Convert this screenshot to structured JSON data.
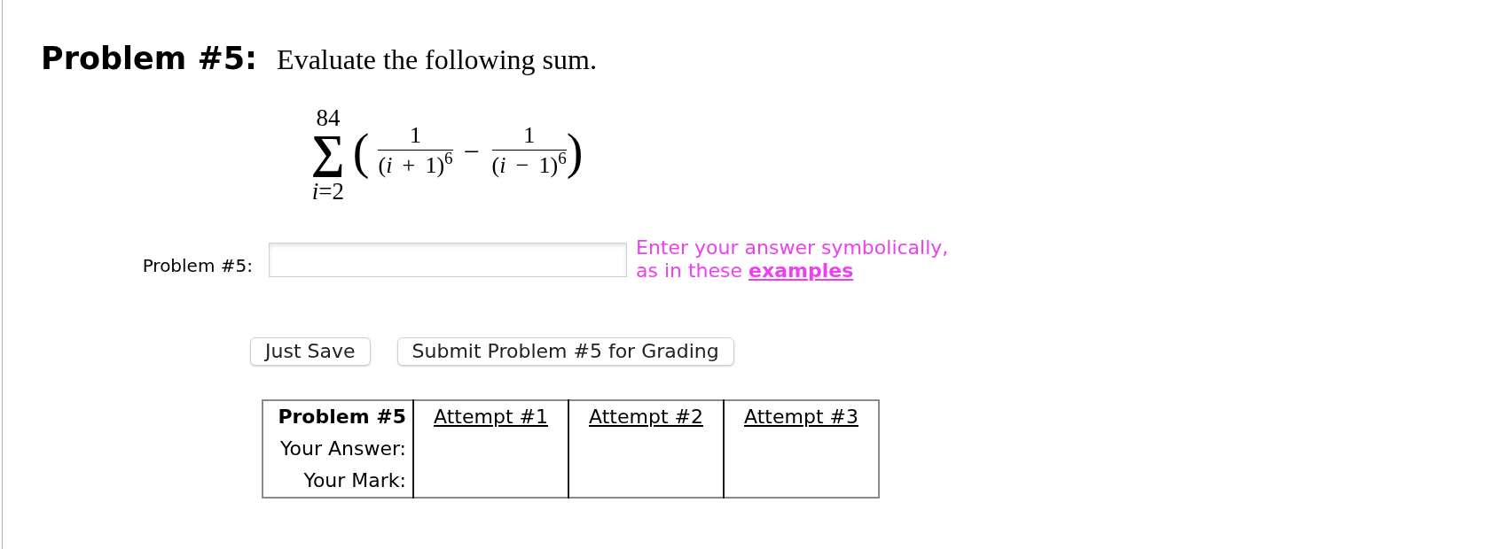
{
  "problem": {
    "title": "Problem #5:",
    "prompt": "Evaluate the following sum."
  },
  "formula": {
    "upper_limit": "84",
    "operator": "∑",
    "lower_limit": "*i*=2",
    "open": "(",
    "terms": [
      {
        "numerator": "1",
        "denominator": "(*i* + 1)$^{6}$"
      },
      {
        "numerator": "1",
        "denominator": "(*i* − 1)$^{6}$"
      }
    ],
    "separator": "−",
    "close": ")"
  },
  "answer": {
    "label": "Problem #5:",
    "hint_lines": [
      "Enter your answer symbolically,",
      "as in these"
    ],
    "hint_link": "examples"
  },
  "buttons": [
    {
      "label": "Just Save"
    },
    {
      "label": "Submit Problem #5 for Grading"
    }
  ],
  "attempts_table": {
    "heading": "Problem #5",
    "columns": [
      "Attempt #1",
      "Attempt #2",
      "Attempt #3"
    ],
    "rows": [
      {
        "label": "Your Answer:"
      },
      {
        "label": "Your Mark:"
      }
    ]
  }
}
